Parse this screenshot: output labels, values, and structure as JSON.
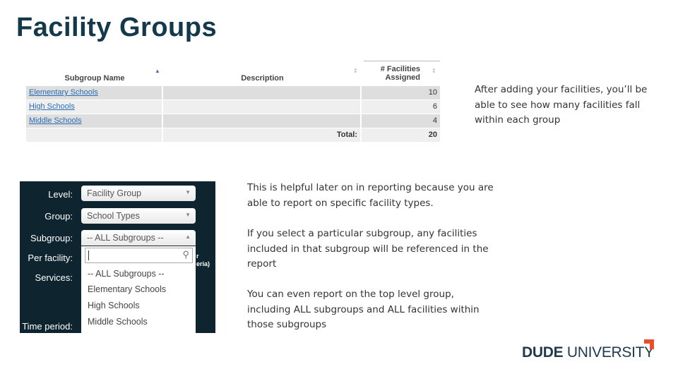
{
  "title": "Facility Groups",
  "table": {
    "headers": [
      "Subgroup Name",
      "Description",
      "# Facilities",
      "Assigned"
    ],
    "rows": [
      {
        "name": "Elementary Schools",
        "description": "",
        "count": "10"
      },
      {
        "name": "High Schools",
        "description": "",
        "count": "6"
      },
      {
        "name": "Middle Schools",
        "description": "",
        "count": "4"
      }
    ],
    "total_label": "Total:",
    "total": "20"
  },
  "notes": [
    "After adding your facilities, you’ll be able to see how many facilities fall within each group",
    "This is helpful later on in reporting because you are able to report on specific facility types.",
    "If you select a particular subgroup, any facilities included in that subgroup will be referenced in the report",
    "You can even report on the top level group, including ALL subgroups and ALL facilities within those subgroups"
  ],
  "form": {
    "level_label": "Level:",
    "level_value": "Facility Group",
    "group_label": "Group:",
    "group_value": "School Types",
    "subgroup_label": "Subgroup:",
    "subgroup_value": "-- ALL Subgroups --",
    "per_facility_label": "Per facility:",
    "services_label": "Services:",
    "time_period_label": "Time period:",
    "search_value": "",
    "partial_text_1": "r",
    "partial_text_2": "eria)",
    "options": [
      "-- ALL Subgroups --",
      "Elementary Schools",
      "High Schools",
      "Middle Schools"
    ]
  },
  "logo": {
    "bold": "DUDE",
    "light": "UNIVERSITY",
    "accent": "#e8502a"
  }
}
